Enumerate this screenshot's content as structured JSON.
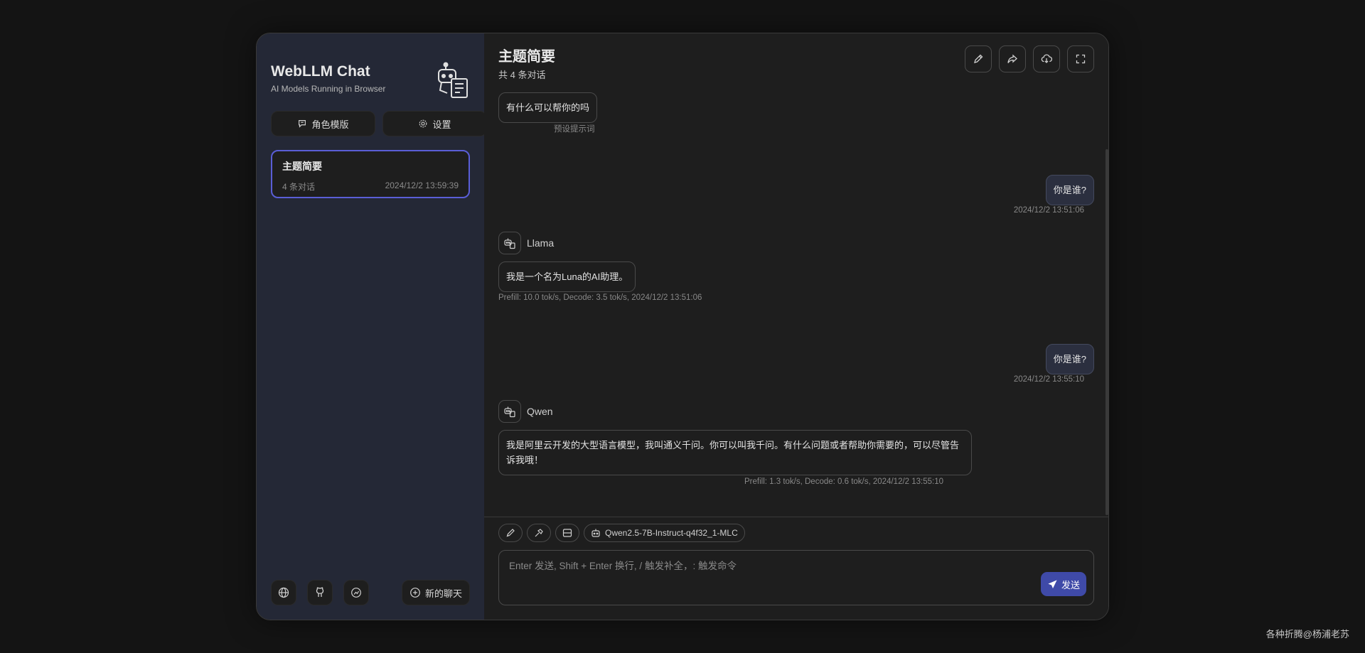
{
  "sidebar": {
    "app_title": "WebLLM Chat",
    "app_subtitle": "AI Models Running in Browser",
    "masks_label": "角色模版",
    "settings_label": "设置",
    "chats": [
      {
        "title": "主题简要",
        "count": "4 条对话",
        "time": "2024/12/2 13:59:39"
      }
    ],
    "new_chat_label": "新的聊天"
  },
  "header": {
    "title": "主题简要",
    "subtitle": "共 4 条对话"
  },
  "messages": {
    "preset": {
      "text": "有什么可以帮你的吗",
      "note": "预设提示词"
    },
    "user1": {
      "text": "你是谁?",
      "time": "2024/12/2 13:51:06"
    },
    "bot1": {
      "model": "Llama",
      "text": "我是一个名为Luna的AI助理。",
      "meta": "Prefill: 10.0 tok/s,  Decode: 3.5 tok/s,  2024/12/2 13:51:06"
    },
    "user2": {
      "text": "你是谁?",
      "time": "2024/12/2 13:55:10"
    },
    "bot2": {
      "model": "Qwen",
      "text": "我是阿里云开发的大型语言模型，我叫通义千问。你可以叫我千问。有什么问题或者帮助你需要的，可以尽管告诉我哦！",
      "meta": "Prefill: 1.3 tok/s,  Decode: 0.6 tok/s,  2024/12/2 13:55:10"
    }
  },
  "composer": {
    "model_chip": "Qwen2.5-7B-Instruct-q4f32_1-MLC",
    "placeholder": "Enter 发送, Shift + Enter 换行, / 触发补全，: 触发命令",
    "send_label": "发送"
  },
  "watermark": "各种折腾@杨浦老苏",
  "colors": {
    "accent": "#5a5ed6",
    "send": "#3f4aa8",
    "sidebar": "#242836"
  }
}
